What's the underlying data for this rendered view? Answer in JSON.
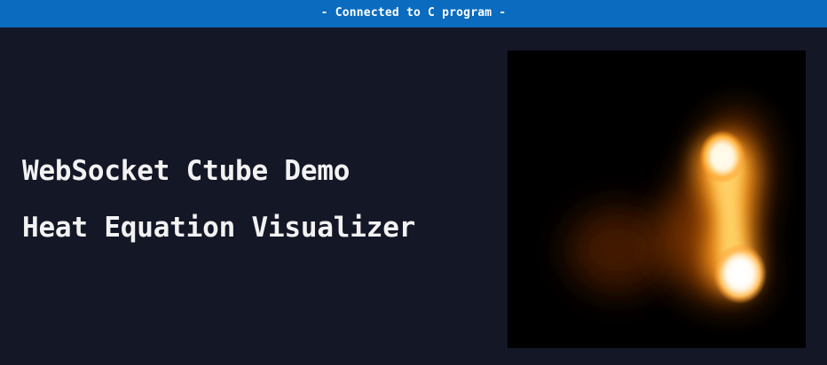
{
  "status": {
    "text": "- Connected to C program -",
    "color": "#0a6bbf"
  },
  "main": {
    "title": "WebSocket Ctube Demo",
    "subtitle": "Heat Equation Visualizer",
    "background": "#141726"
  },
  "visualizer": {
    "background": "#000000",
    "heat_colors": [
      "#ffffff",
      "#ffd060",
      "#ff8a10",
      "#7a3206",
      "#000000"
    ]
  }
}
